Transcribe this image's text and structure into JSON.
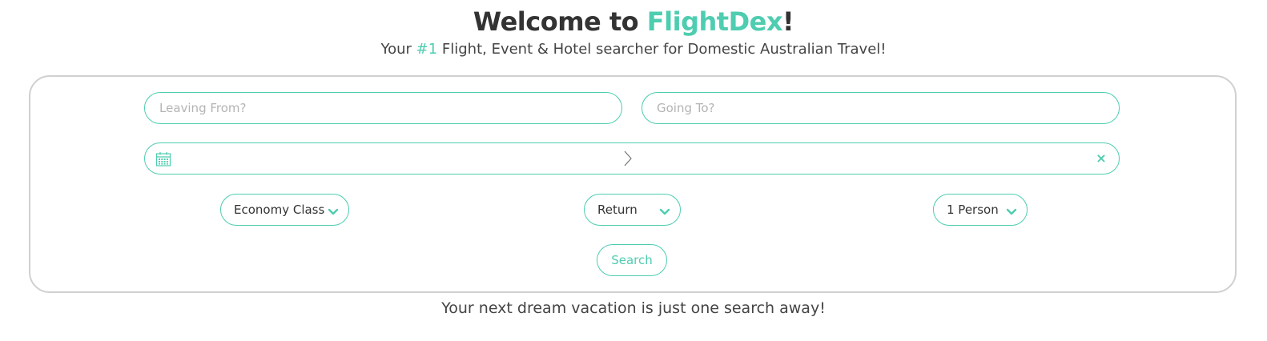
{
  "header": {
    "title_prefix": "Welcome to ",
    "title_brand": "FlightDex",
    "title_suffix": "!",
    "subtitle_prefix": "Your ",
    "subtitle_rank": "#1",
    "subtitle_suffix": " Flight, Event & Hotel searcher for Domestic Australian Travel!"
  },
  "form": {
    "leaving_placeholder": "Leaving From?",
    "going_placeholder": "Going To?",
    "leaving_value": "",
    "going_value": "",
    "date_range_value": "",
    "clear_label": "×",
    "class_select": "Economy Class",
    "trip_select": "Return",
    "people_select": "1 Person",
    "search_label": "Search"
  },
  "footer": {
    "tagline": "Your next dream vacation is just one search away!"
  },
  "colors": {
    "accent": "#4ecdb0",
    "border_card": "#d0d0d0",
    "text": "#333333"
  },
  "icons": {
    "calendar": "calendar-icon",
    "arrow": "chevron-right-icon",
    "clear": "close-icon",
    "dropdown": "chevron-down-icon"
  }
}
